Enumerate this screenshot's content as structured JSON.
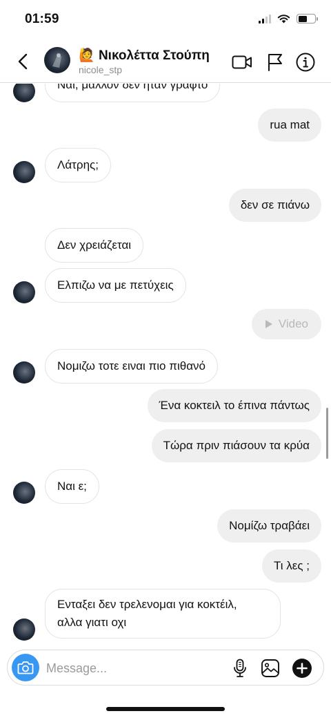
{
  "status_bar": {
    "time": "01:59"
  },
  "header": {
    "emoji": "🙋",
    "name": "Νικολέττα Στούπη",
    "username": "nicole_stp"
  },
  "messages": [
    {
      "side": "in",
      "text": "Ναι, μαλλον δεν ηταν γραφτο",
      "avatar": true
    },
    {
      "side": "out",
      "text": "rua mat"
    },
    {
      "side": "in",
      "text": "Λάτρης;",
      "avatar": true
    },
    {
      "side": "out",
      "text": "δεν σε πιάνω"
    },
    {
      "side": "in",
      "text": "Δεν χρειάζεται",
      "avatar": false
    },
    {
      "side": "in",
      "text": "Ελπιζω να με πετύχεις",
      "avatar": true
    },
    {
      "side": "out",
      "type": "video",
      "text": "Video"
    },
    {
      "side": "in",
      "text": "Νομιζω τοτε ειναι πιο πιθανό",
      "avatar": true
    },
    {
      "side": "out",
      "text": "Ένα κοκτειλ το έπινα πάντως"
    },
    {
      "side": "out",
      "text": "Τώρα πριν πιάσουν τα κρύα"
    },
    {
      "side": "in",
      "text": "Ναι ε;",
      "avatar": true
    },
    {
      "side": "out",
      "text": "Νομίζω τραβάει"
    },
    {
      "side": "out",
      "text": "Τι λες ;"
    },
    {
      "side": "in",
      "text": "Ενταξει δεν τρελενομαι για κοκτέιλ,",
      "text2": "αλλα γιατι οχι",
      "avatar": true
    }
  ],
  "composer": {
    "placeholder": "Message..."
  },
  "colors": {
    "accent": "#3897f0",
    "outgoing_bubble": "#efefef",
    "incoming_border": "#e3e3e3"
  },
  "icons": [
    "back-chevron",
    "video-call",
    "flag",
    "info",
    "camera",
    "microphone",
    "gallery",
    "plus"
  ]
}
